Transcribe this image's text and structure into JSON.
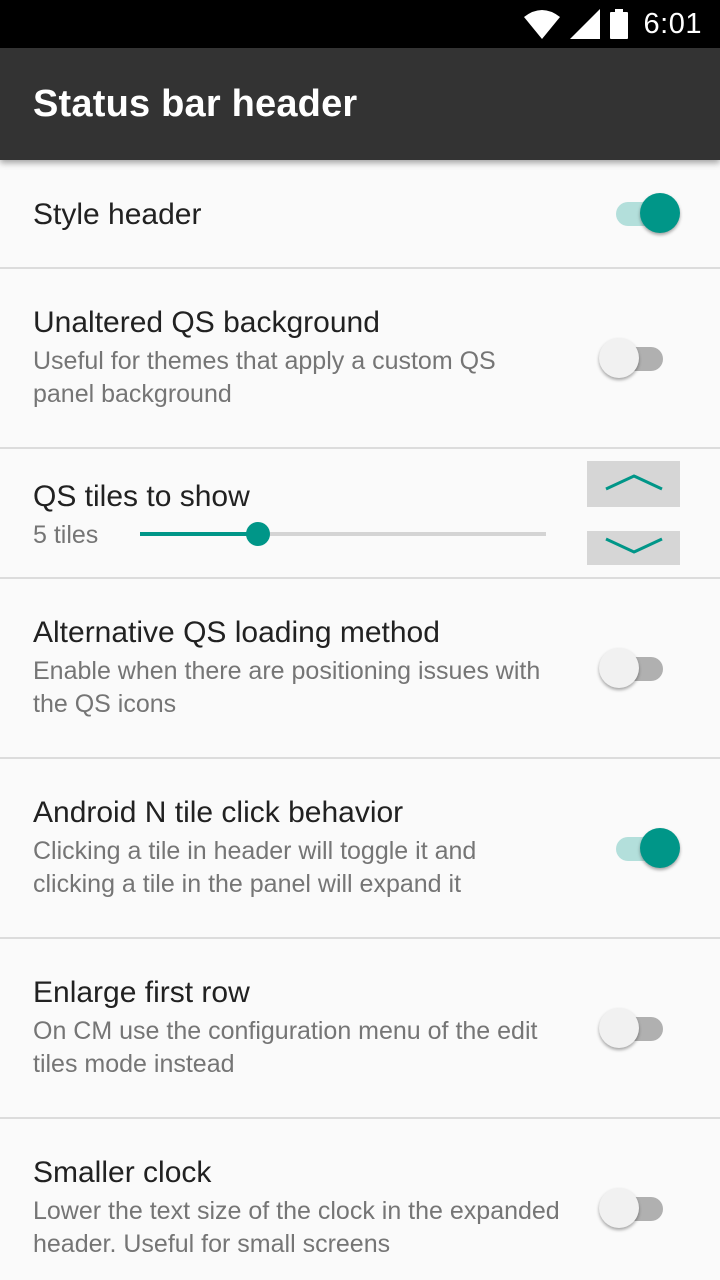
{
  "status_bar": {
    "time": "6:01",
    "icons": [
      "wifi-icon",
      "signal-icon",
      "battery-icon"
    ]
  },
  "app_bar": {
    "title": "Status bar header"
  },
  "accent_color": "#009688",
  "settings": [
    {
      "id": "style-header",
      "title": "Style header",
      "summary": "",
      "type": "switch",
      "checked": true
    },
    {
      "id": "unaltered-qs-background",
      "title": "Unaltered QS background",
      "summary": "Useful for themes that apply a custom QS panel background",
      "type": "switch",
      "checked": false
    },
    {
      "id": "qs-tiles-to-show",
      "title": "QS tiles to show",
      "type": "slider",
      "value_label": "5 tiles",
      "fraction": 0.29
    },
    {
      "id": "alternative-qs-loading",
      "title": "Alternative QS loading method",
      "summary": "Enable when there are positioning issues with the QS icons",
      "type": "switch",
      "checked": false
    },
    {
      "id": "android-n-tile-click",
      "title": "Android N tile click behavior",
      "summary": "Clicking a tile in header will toggle it and clicking a tile in the panel will expand it",
      "type": "switch",
      "checked": true
    },
    {
      "id": "enlarge-first-row",
      "title": "Enlarge first row",
      "summary": "On CM use the configuration menu of the edit tiles mode instead",
      "type": "switch",
      "checked": false
    },
    {
      "id": "smaller-clock",
      "title": "Smaller clock",
      "summary": "Lower the text size of the clock in the expanded header. Useful for small screens",
      "type": "switch",
      "checked": false
    }
  ]
}
